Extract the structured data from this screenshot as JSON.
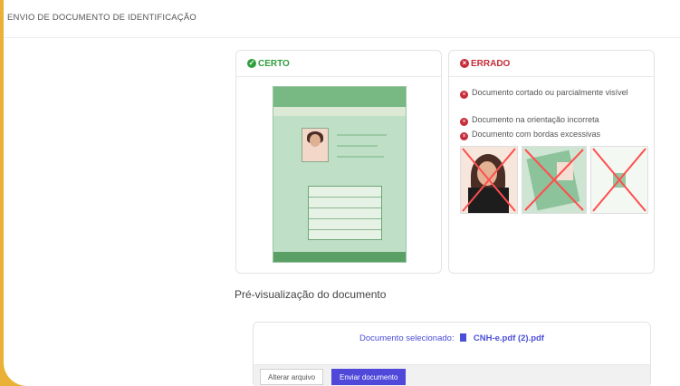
{
  "header": {
    "title": "ENVIO DE DOCUMENTO DE IDENTIFICAÇÃO"
  },
  "panels": {
    "right": {
      "title": "CERTO",
      "icon": "check-circle-icon",
      "color": "#2f9e3e"
    },
    "wrong": {
      "title": "ERRADO",
      "icon": "x-circle-icon",
      "color": "#c62d39",
      "items": [
        {
          "text": "Documento cortado ou parcialmente visível"
        },
        {
          "text": "Documento na orientação incorreta"
        },
        {
          "text": "Documento com bordas excessivas"
        }
      ]
    }
  },
  "preview": {
    "title": "Pré-visualização do documento",
    "selected_label": "Documento selecionado:",
    "selected_file": "CNH-e.pdf (2).pdf",
    "buttons": {
      "change": "Alterar arquivo",
      "send": "Enviar documento"
    }
  }
}
